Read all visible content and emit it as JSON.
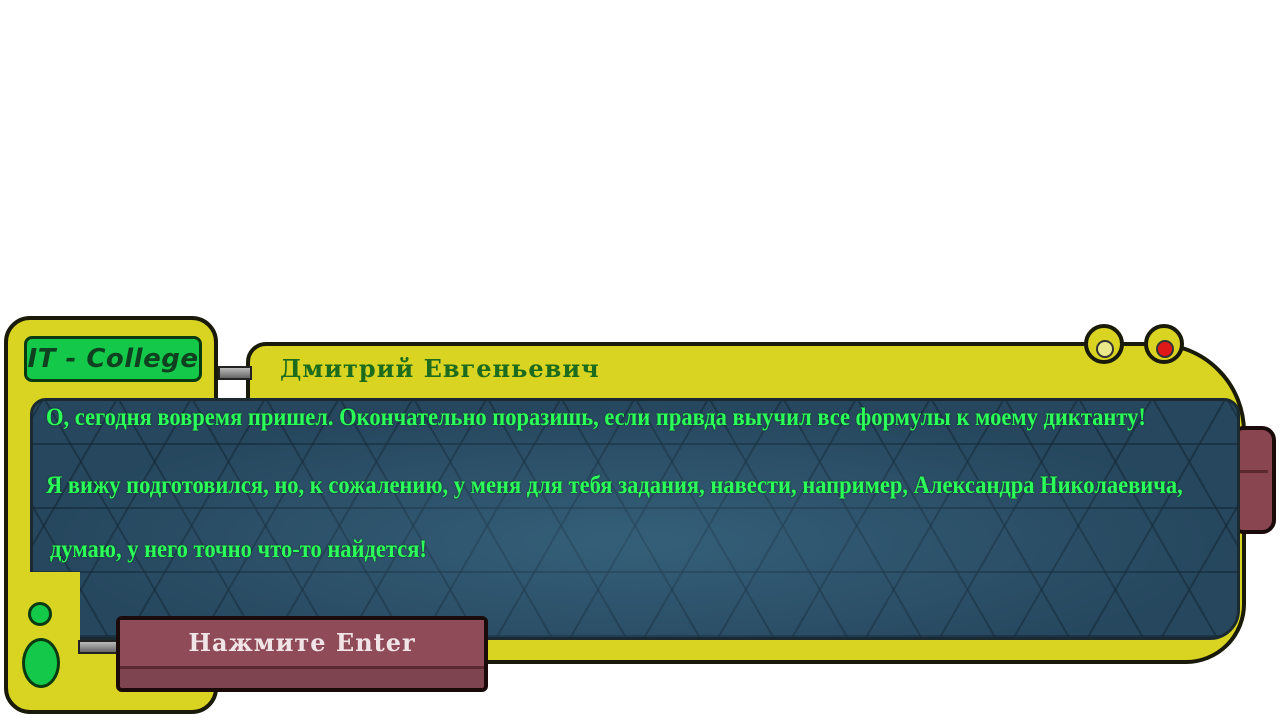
{
  "dialog": {
    "logo": "IT - College",
    "speaker": "Дмитрий Евгеньевич",
    "lines": [
      "О, сегодня вовремя пришел. Окончательно поразишь, если правда выучил все формулы к моему диктанту!",
      "Я вижу подготовился, но, к сожалению, у меня для тебя задания, навести, например, Александра Николаевича,",
      "думаю, у него точно что-то найдется!"
    ],
    "continue_label": "Нажмите Enter"
  },
  "colors": {
    "frame": "#d8d421",
    "screen": "#26475e",
    "text": "#2bff5a",
    "speaker": "#1d6b1d",
    "button": "#7e4450"
  }
}
